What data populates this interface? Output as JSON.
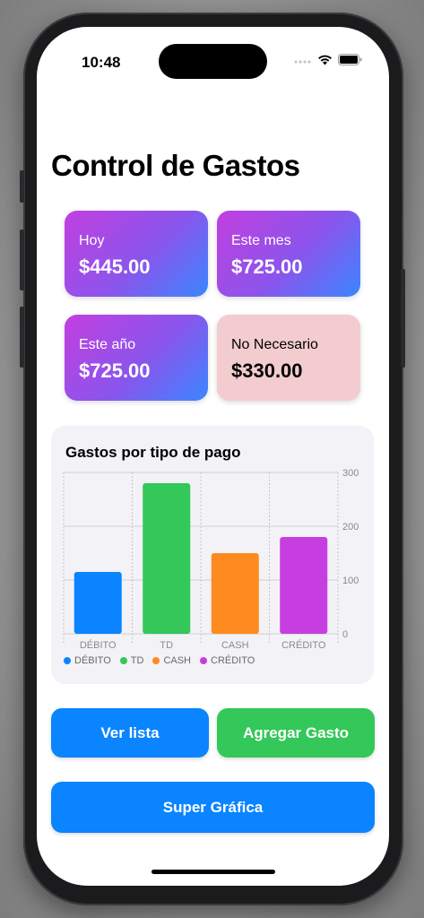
{
  "status": {
    "time": "10:48"
  },
  "title": "Control de Gastos",
  "cards": [
    {
      "label": "Hoy",
      "value": "$445.00",
      "style": "gradient"
    },
    {
      "label": "Este mes",
      "value": "$725.00",
      "style": "gradient"
    },
    {
      "label": "Este año",
      "value": "$725.00",
      "style": "gradient"
    },
    {
      "label": "No Necesario",
      "value": "$330.00",
      "style": "pink"
    }
  ],
  "chart_title": "Gastos por tipo de pago",
  "chart_data": {
    "type": "bar",
    "title": "Gastos por tipo de pago",
    "categories": [
      "DÉBITO",
      "TD",
      "CASH",
      "CRÉDITO"
    ],
    "values": [
      115,
      280,
      150,
      180
    ],
    "colors": [
      "#0a84ff",
      "#34c759",
      "#ff8a1f",
      "#c73ee0"
    ],
    "ylim": [
      0,
      300
    ],
    "y_ticks": [
      "0",
      "100",
      "200",
      "300"
    ],
    "y_axis_side": "right",
    "grid": true,
    "legend": [
      "DÉBITO",
      "TD",
      "CASH",
      "CRÉDITO"
    ],
    "legend_placement": "bottom-left"
  },
  "buttons": {
    "ver_lista": "Ver lista",
    "agregar_gasto": "Agregar Gasto",
    "super_grafica": "Super Gráfica"
  },
  "colors": {
    "blue": "#0a84ff",
    "green": "#34c759",
    "pink_card": "#f3cccf"
  }
}
